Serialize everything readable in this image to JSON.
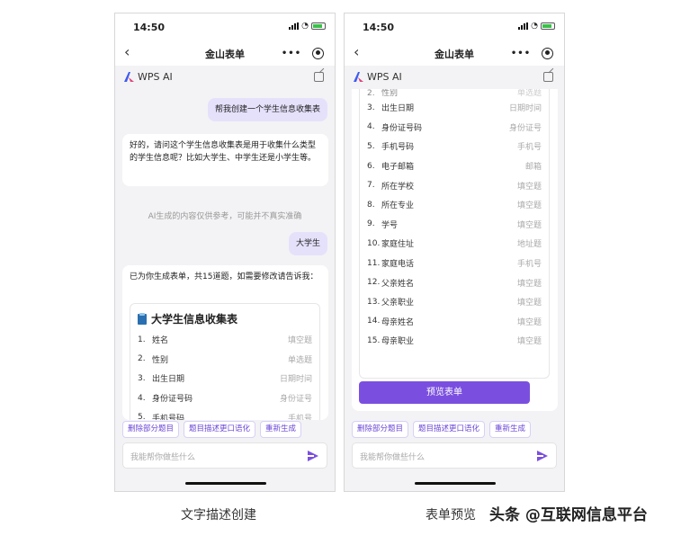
{
  "phone_left": {
    "status": {
      "time": "14:50"
    },
    "nav": {
      "back": "‹",
      "title": "金山表单",
      "more": "•••"
    },
    "ai_header": {
      "title": "WPS AI"
    },
    "messages": {
      "user_1": "帮我创建一个学生信息收集表",
      "ai_1": "好的，请问这个学生信息收集表是用于收集什么类型的学生信息呢？比如大学生、中学生还是小学生等。",
      "disclaimer": "AI生成的内容仅供参考，可能并不真实准确",
      "user_2": "大学生",
      "ai_2": "已为你生成表单，共15道题，如需要修改请告诉我："
    },
    "form_card": {
      "title": "大学生信息收集表",
      "fields": [
        {
          "num": "1.",
          "name": "姓名",
          "type": "填空题"
        },
        {
          "num": "2.",
          "name": "性别",
          "type": "单选题"
        },
        {
          "num": "3.",
          "name": "出生日期",
          "type": "日期时间"
        },
        {
          "num": "4.",
          "name": "身份证号码",
          "type": "身份证号"
        },
        {
          "num": "5.",
          "name": "手机号码",
          "type": "手机号"
        }
      ]
    },
    "actions": [
      "删除部分题目",
      "题目描述更口语化",
      "重新生成"
    ],
    "input": {
      "placeholder": "我能帮你做些什么"
    }
  },
  "phone_right": {
    "status": {
      "time": "14:50"
    },
    "nav": {
      "back": "‹",
      "title": "金山表单",
      "more": "•••"
    },
    "ai_header": {
      "title": "WPS AI"
    },
    "form_card": {
      "partial_top": {
        "num": "2.",
        "name": "性别",
        "type": "单选题"
      },
      "fields": [
        {
          "num": "3.",
          "name": "出生日期",
          "type": "日期时间"
        },
        {
          "num": "4.",
          "name": "身份证号码",
          "type": "身份证号"
        },
        {
          "num": "5.",
          "name": "手机号码",
          "type": "手机号"
        },
        {
          "num": "6.",
          "name": "电子邮箱",
          "type": "邮箱"
        },
        {
          "num": "7.",
          "name": "所在学校",
          "type": "填空题"
        },
        {
          "num": "8.",
          "name": "所在专业",
          "type": "填空题"
        },
        {
          "num": "9.",
          "name": "学号",
          "type": "填空题"
        },
        {
          "num": "10.",
          "name": "家庭住址",
          "type": "地址题"
        },
        {
          "num": "11.",
          "name": "家庭电话",
          "type": "手机号"
        },
        {
          "num": "12.",
          "name": "父亲姓名",
          "type": "填空题"
        },
        {
          "num": "13.",
          "name": "父亲职业",
          "type": "填空题"
        },
        {
          "num": "14.",
          "name": "母亲姓名",
          "type": "填空题"
        },
        {
          "num": "15.",
          "name": "母亲职业",
          "type": "填空题"
        }
      ],
      "preview_button": "预览表单"
    },
    "actions": [
      "删除部分题目",
      "题目描述更口语化",
      "重新生成"
    ],
    "input": {
      "placeholder": "我能帮你做些什么"
    }
  },
  "captions": {
    "left": "文字描述创建",
    "right": "表单预览"
  },
  "watermark": "头条 @互联网信息平台",
  "colors": {
    "accent": "#7a4fe0",
    "user_bubble": "#e5e1fb",
    "chip_text": "#6b47d6"
  }
}
